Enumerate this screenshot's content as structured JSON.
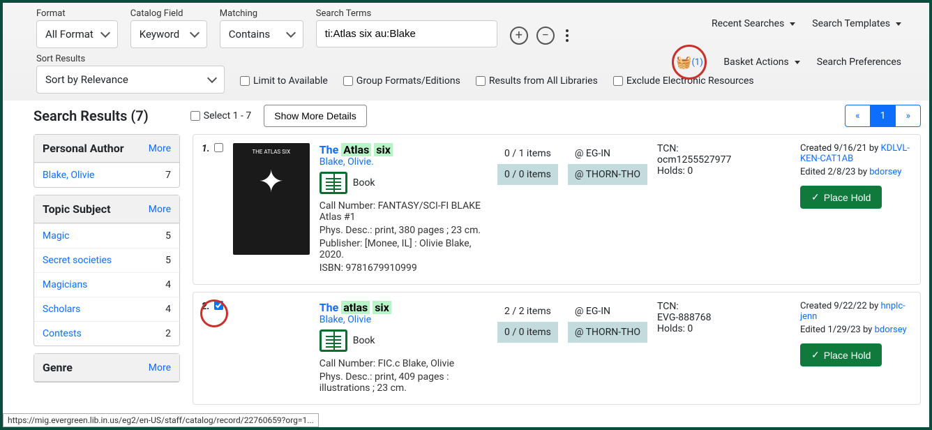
{
  "filters": {
    "format_label": "Format",
    "format_value": "All Format",
    "field_label": "Catalog Field",
    "field_value": "Keyword",
    "match_label": "Matching",
    "match_value": "Contains",
    "terms_label": "Search Terms",
    "terms_value": "ti:Atlas six au:Blake",
    "sort_label": "Sort Results",
    "sort_value": "Sort by Relevance"
  },
  "top_menu": {
    "recent": "Recent Searches",
    "templates": "Search Templates",
    "basket_count": "(1)",
    "basket_actions": "Basket Actions",
    "prefs": "Search Preferences"
  },
  "checks": {
    "avail": "Limit to Available",
    "group": "Group Formats/Editions",
    "all": "Results from All Libraries",
    "excl": "Exclude Electronic Resources"
  },
  "results_header": "Search Results (7)",
  "select_range": "Select 1 - 7",
  "show_more": "Show More Details",
  "pager": {
    "prev": "«",
    "page": "1",
    "next": "»"
  },
  "facets": {
    "author": {
      "title": "Personal Author",
      "more": "More",
      "items": [
        {
          "label": "Blake, Olivie",
          "count": "7"
        }
      ]
    },
    "topic": {
      "title": "Topic Subject",
      "more": "More",
      "items": [
        {
          "label": "Magic",
          "count": "5"
        },
        {
          "label": "Secret societies",
          "count": "5"
        },
        {
          "label": "Magicians",
          "count": "4"
        },
        {
          "label": "Scholars",
          "count": "4"
        },
        {
          "label": "Contests",
          "count": "2"
        }
      ]
    },
    "genre": {
      "title": "Genre",
      "more": "More"
    }
  },
  "results": [
    {
      "num": "1.",
      "checked": false,
      "title_pre": "The ",
      "hl1": "Atlas",
      "hl2": "six",
      "author": "Blake, Olivie.",
      "format": "Book",
      "cover_text": "THE ATLAS SIX",
      "callno": "Call Number: FANTASY/SCI-FI BLAKE Atlas #1",
      "phys": "Phys. Desc.: print, 380 pages ; 23 cm.",
      "pub": "Publisher: [Monee, IL] : Olivie Blake, 2020.",
      "isbn": "ISBN: 9781679910999",
      "items1": "0 / 1 items",
      "loc1": "@ EG-IN",
      "items2": "0 / 0 items",
      "loc2": "@ THORN-THO",
      "tcn_label": "TCN:",
      "tcn": "ocm1255527977",
      "holds": "Holds: 0",
      "created": "Created 9/16/21 by ",
      "created_by": "KDLVL-KEN-CAT1AB",
      "edited": "Edited 2/8/23 by ",
      "edited_by": "bdorsey",
      "hold_btn": "Place Hold"
    },
    {
      "num": "2.",
      "checked": true,
      "title_pre": "The ",
      "hl1": "atlas",
      "hl2": "six",
      "author": "Blake, Olivie",
      "format": "Book",
      "callno": "Call Number: FIC.c Blake, Olivie",
      "phys": "Phys. Desc.: print, 409 pages : illustrations ; 23 cm.",
      "items1": "2 / 2 items",
      "loc1": "@ EG-IN",
      "items2": "0 / 0 items",
      "loc2": "@ THORN-THO",
      "tcn_label": "TCN:",
      "tcn": "EVG-888768",
      "holds": "Holds: 0",
      "created": "Created 9/22/22 by ",
      "created_by": "hnplc-jenn",
      "edited": "Edited 1/29/23 by ",
      "edited_by": "bdorsey",
      "hold_btn": "Place Hold"
    }
  ],
  "status_url": "https://mig.evergreen.lib.in.us/eg2/en-US/staff/catalog/record/22760659?org=1..."
}
